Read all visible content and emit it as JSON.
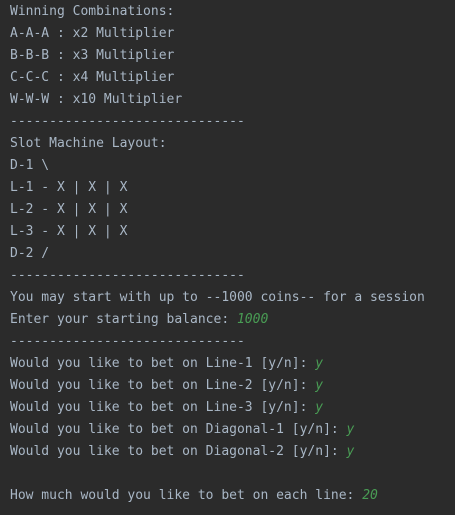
{
  "console": {
    "combos_title": "Winning Combinations:",
    "combo_1": "A-A-A : x2 Multiplier",
    "combo_2": "B-B-B : x3 Multiplier",
    "combo_3": "C-C-C : x4 Multiplier",
    "combo_4": "W-W-W : x10 Multiplier",
    "divider": "------------------------------",
    "layout_title": "Slot Machine Layout:",
    "layout_d1": "D-1 \\",
    "layout_l1": "L-1 - X | X | X",
    "layout_l2": "L-2 - X | X | X",
    "layout_l3": "L-3 - X | X | X",
    "layout_d2": "D-2 /",
    "start_info": "You may start with up to --1000 coins-- for a session",
    "balance_prompt": "Enter your starting balance: ",
    "balance_input": "1000",
    "bet_line1_prompt": "Would you like to bet on Line-1 [y/n]: ",
    "bet_line1_input": "y",
    "bet_line2_prompt": "Would you like to bet on Line-2 [y/n]: ",
    "bet_line2_input": "y",
    "bet_line3_prompt": "Would you like to bet on Line-3 [y/n]: ",
    "bet_line3_input": "y",
    "bet_diag1_prompt": "Would you like to bet on Diagonal-1 [y/n]: ",
    "bet_diag1_input": "y",
    "bet_diag2_prompt": "Would you like to bet on Diagonal-2 [y/n]: ",
    "bet_diag2_input": "y",
    "bet_amount_prompt": "How much would you like to bet on each line: ",
    "bet_amount_input": "20"
  },
  "colors": {
    "background": "#2b2b2b",
    "text": "#a9b7c6",
    "user_input": "#499c54"
  }
}
